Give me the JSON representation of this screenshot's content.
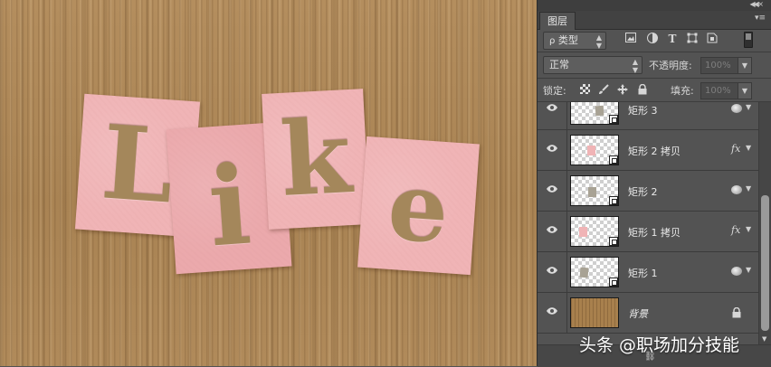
{
  "canvas": {
    "letters": [
      "L",
      "i",
      "k",
      "e"
    ],
    "tile_color": "#f0b4b6",
    "cardboard_color": "#b08a5a"
  },
  "panel": {
    "tab_label": "图层",
    "filter": {
      "kind_label": "类型",
      "icons": [
        "image-filter-icon",
        "adjustment-filter-icon",
        "type-filter-icon",
        "shape-filter-icon",
        "smart-object-filter-icon"
      ]
    },
    "blend_mode": "正常",
    "opacity_label": "不透明度:",
    "opacity_value": "100%",
    "lock_label": "锁定:",
    "fill_label": "填充:",
    "fill_value": "100%",
    "layers": [
      {
        "name": "矩形 3",
        "has_fx": false,
        "shape_color": "#a8a294"
      },
      {
        "name": "矩形 2 拷贝",
        "has_fx": true,
        "shape_color": "#f0b4b6"
      },
      {
        "name": "矩形 2",
        "has_fx": false,
        "shape_color": "#a8a294"
      },
      {
        "name": "矩形 1 拷贝",
        "has_fx": true,
        "shape_color": "#f0b4b6"
      },
      {
        "name": "矩形 1",
        "has_fx": false,
        "shape_color": "#a8a294"
      },
      {
        "name": "背景",
        "locked": true
      }
    ],
    "fx_label": "fx"
  },
  "watermark": "头条 @职场加分技能"
}
